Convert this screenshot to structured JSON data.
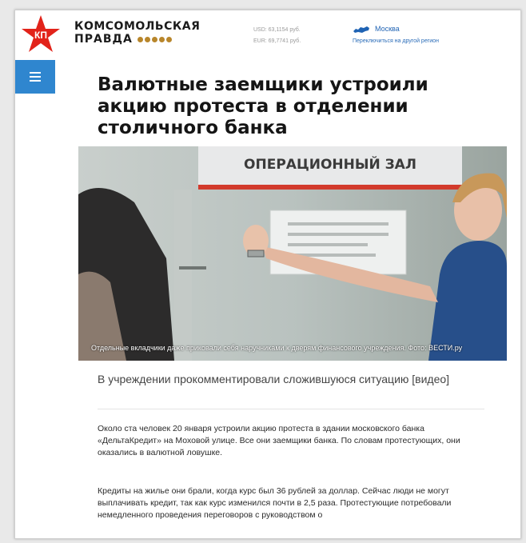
{
  "header": {
    "logo_text": "КП",
    "brand_line1": "КОМСОМОЛЬСКАЯ",
    "brand_line2": "ПРАВДА",
    "rates": {
      "usd": "USD: 63,1154 руб.",
      "eur": "EUR: 69,7741 руб."
    },
    "region": {
      "city": "Москва",
      "change_link": "Переключиться на другой регион"
    }
  },
  "menu": {
    "icon": "hamburger-icon"
  },
  "article": {
    "title": "Валютные заемщики устроили акцию протеста в отделении столичного банка",
    "photo": {
      "sign_text": "ОПЕРАЦИОННЫЙ ЗАЛ",
      "caption": "Отдельные вкладчики даже приковали себя наручниками к дверям финансового учреждения. Фото: ВЕСТИ.ру"
    },
    "subtitle": "В учреждении прокомментировали сложившуюся ситуацию [видео]",
    "paragraphs": [
      "Около ста человек 20 января устроили акцию протеста в здании московского банка «ДельтаКредит» на Моховой улице. Все они заемщики банка. По словам протестующих, они оказались в валютной ловушке.",
      "Кредиты на жилье они брали, когда курс был 36 рублей за доллар. Сейчас люди не могут выплачивать кредит, так как курс изменился почти в 2,5 раза. Протестующие потребовали немедленного проведения переговоров с руководством о"
    ]
  },
  "colors": {
    "brand_red": "#e2231a",
    "menu_blue": "#2f86cf",
    "link_blue": "#1f63b4"
  }
}
